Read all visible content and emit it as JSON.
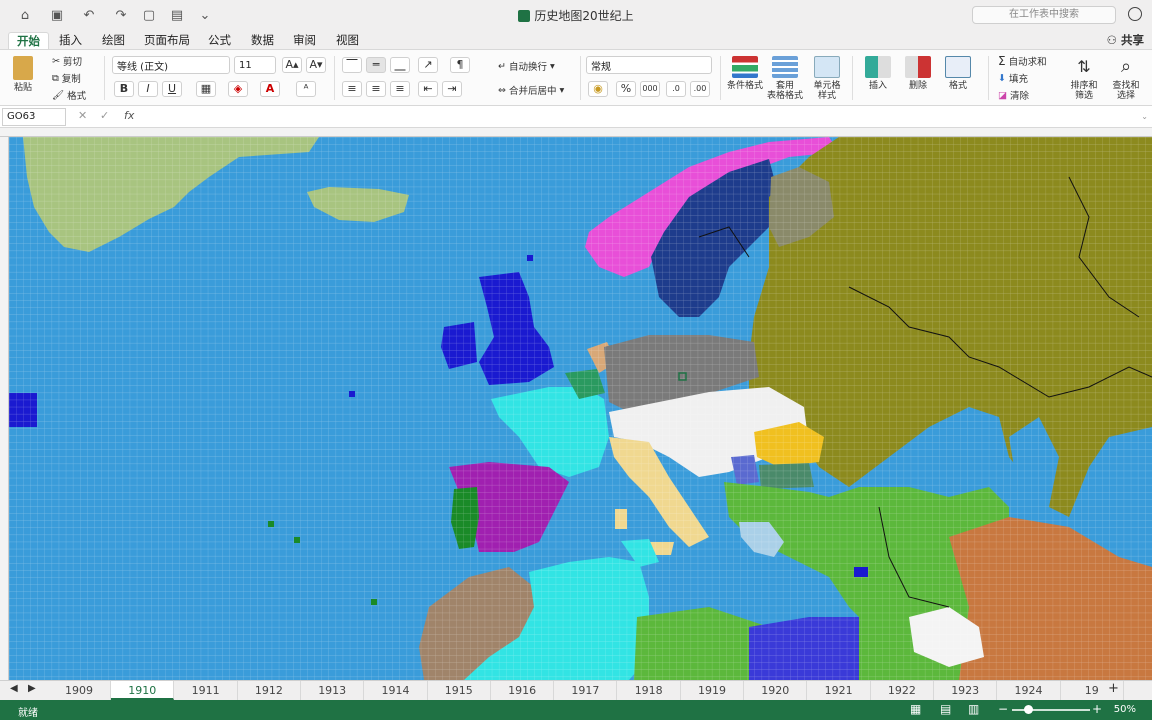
{
  "window": {
    "title": "历史地图20世纪上",
    "search_placeholder": "在工作表中搜索"
  },
  "tabs": [
    "开始",
    "插入",
    "绘图",
    "页面布局",
    "公式",
    "数据",
    "审阅",
    "视图"
  ],
  "active_tab": "开始",
  "share_label": "共享",
  "ribbon": {
    "paste": "粘贴",
    "cut": "剪切",
    "copy": "复制",
    "format_painter": "格式",
    "font_name": "等线 (正文)",
    "font_size": "11",
    "bold": "B",
    "italic": "I",
    "underline": "U",
    "wrap_text": "自动换行",
    "merge_center": "合并后居中",
    "number_format": "常规",
    "percent": "%",
    "thousands": "000",
    "conditional_format": "条件格式",
    "table_format": "套用\n表格格式",
    "cell_style": "单元格\n样式",
    "insert": "插入",
    "delete": "删除",
    "format": "格式",
    "autosum": "自动求和",
    "fill": "填充",
    "clear": "清除",
    "sort_filter": "排序和\n筛选",
    "find_select": "查找和\n选择"
  },
  "formula_bar": {
    "name_box": "GO63",
    "fx": "fx"
  },
  "sheets": [
    "1909",
    "1910",
    "1911",
    "1912",
    "1913",
    "1914",
    "1915",
    "1916",
    "1917",
    "1918",
    "1919",
    "1920",
    "1921",
    "1922",
    "1923",
    "1924",
    "19"
  ],
  "active_sheet": "1910",
  "status": {
    "text": "就绪",
    "zoom": "50%"
  },
  "colors": {
    "excel_green": "#1f7244",
    "sea": "#3a9cda"
  }
}
